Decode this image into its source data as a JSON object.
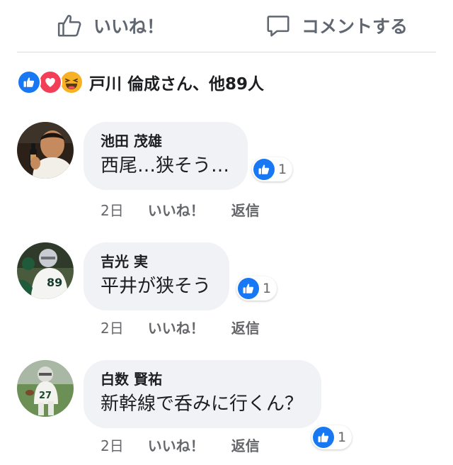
{
  "actions": {
    "like_label": "いいね！",
    "comment_label": "コメントする"
  },
  "reactions": {
    "summary": "戸川 倫成さん、他89人",
    "icons": [
      "like-icon",
      "love-icon",
      "haha-icon"
    ]
  },
  "comments": [
    {
      "author": "池田 茂雄",
      "text": "西尾…狭そう…",
      "likes": "1",
      "time": "2日",
      "like_label": "いいね！",
      "reply_label": "返信"
    },
    {
      "author": "吉光 実",
      "text": "平井が狭そう",
      "likes": "1",
      "time": "2日",
      "like_label": "いいね！",
      "reply_label": "返信"
    },
    {
      "author": "白数 賢祐",
      "text": "新幹線で呑みに行くん？",
      "likes": "1",
      "time": "2日",
      "like_label": "いいね！",
      "reply_label": "返信"
    }
  ],
  "colors": {
    "accent": "#1877f2",
    "bubble": "#f0f2f5",
    "muted": "#65676b"
  }
}
